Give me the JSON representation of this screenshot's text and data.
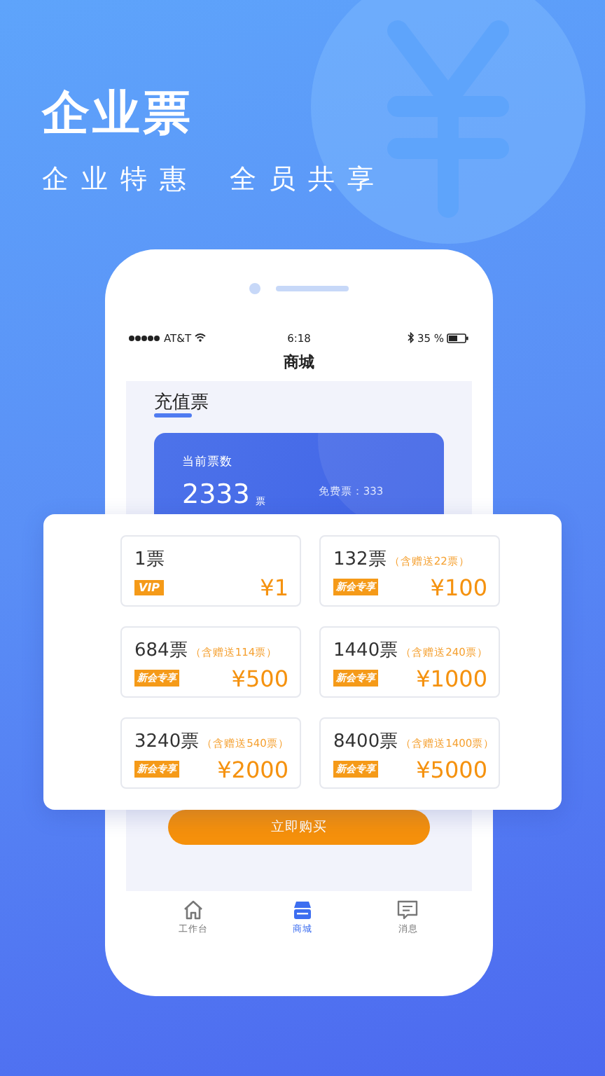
{
  "promo": {
    "title": "企业票",
    "subtitle": [
      "企业特惠",
      "全员共享"
    ]
  },
  "phone": {
    "status_bar": {
      "carrier": "AT&T",
      "time": "6:18",
      "battery": "35 %"
    },
    "nav_title": "商城",
    "section_title": "充值票",
    "balance": {
      "label": "当前票数",
      "count": "2333",
      "unit": "票",
      "free": "免费票：333"
    },
    "buy_button": "立即购买",
    "tabs": [
      {
        "label": "工作台",
        "selected": false
      },
      {
        "label": "商城",
        "selected": true
      },
      {
        "label": "消息",
        "selected": false
      }
    ]
  },
  "packages": [
    {
      "tickets": "1票",
      "badge": {
        "kind": "vip",
        "text": "VIP"
      },
      "price": "¥1"
    },
    {
      "tickets": "132票",
      "bonus": "（含赠送22票）",
      "badge": {
        "kind": "new",
        "text": "新会专享"
      },
      "price": "¥100"
    },
    {
      "tickets": "684票",
      "bonus": "（含赠送114票）",
      "badge": {
        "kind": "new",
        "text": "新会专享"
      },
      "price": "¥500"
    },
    {
      "tickets": "1440票",
      "bonus": "（含赠送240票）",
      "badge": {
        "kind": "new",
        "text": "新会专享"
      },
      "price": "¥1000"
    },
    {
      "tickets": "3240票",
      "bonus": "（含赠送540票）",
      "badge": {
        "kind": "new",
        "text": "新会专享"
      },
      "price": "¥2000"
    },
    {
      "tickets": "8400票",
      "bonus": "（含赠送1400票）",
      "badge": {
        "kind": "new",
        "text": "新会专享"
      },
      "price": "¥5000"
    }
  ]
}
